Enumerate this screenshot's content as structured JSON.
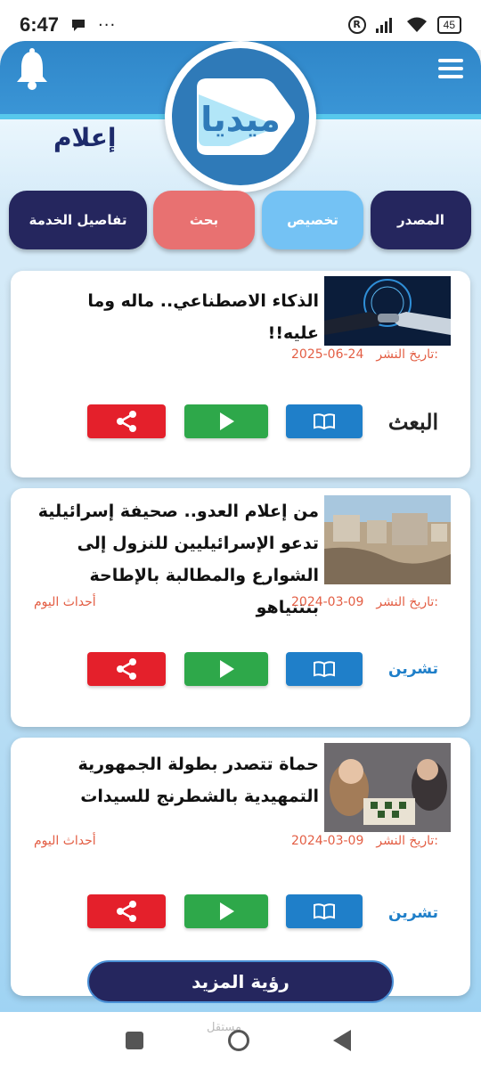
{
  "status_bar": {
    "time": "6:47",
    "dots": "···",
    "r_badge": "R",
    "battery": "45"
  },
  "header": {
    "logo_text": "ميديا",
    "brand_label": "إعلام",
    "icons": {
      "bell": "bell-icon",
      "menu": "hamburger-menu-icon"
    },
    "colors": {
      "primary": "#25265e",
      "accent": "#2f7ab8",
      "header": "#3a95d6"
    }
  },
  "filters": {
    "source": "المصدر",
    "customize": "تخصيص",
    "search": "بحث",
    "details": "تفاصيل الخدمة"
  },
  "articles": [
    {
      "title": "الذكاء الاصطناعي.. ماله وما عليه!!",
      "date_label": ":تاريخ النشر",
      "date": "2025-06-24",
      "category": "",
      "source_logo_text": "البعث"
    },
    {
      "title": "من إعلام العدو.. صحيفة إسرائيلية تدعو الإسرائيليين للنزول إلى الشوارع والمطالبة بالإطاحة بنتنياهو",
      "date_label": ":تاريخ النشر",
      "date": "2024-03-09",
      "category": "أحداث اليوم",
      "source_logo_text": "تشرين"
    },
    {
      "title": "حماة تتصدر بطولة الجمهورية التمهيدية بالشطرنج للسيدات",
      "date_label": ":تاريخ النشر",
      "date": "2024-03-09",
      "category": "أحداث اليوم",
      "source_logo_text": "تشرين"
    }
  ],
  "actions": {
    "icons": {
      "read": "book-icon",
      "play": "play-icon",
      "share": "share-icon"
    }
  },
  "more_button": "رؤية المزيد",
  "nav": {
    "watermark": "مستقل"
  }
}
